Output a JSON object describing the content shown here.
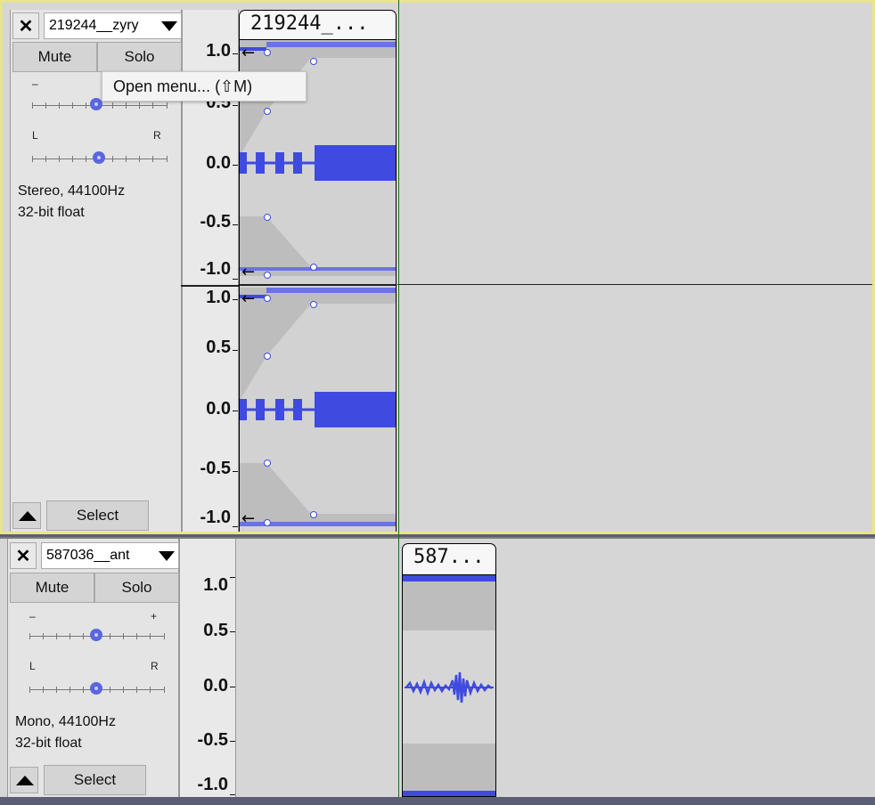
{
  "tracks": [
    {
      "name": "219244__zyry",
      "mute_label": "Mute",
      "solo_label": "Solo",
      "gain_minus": "–",
      "gain_plus": "+",
      "pan_left": "L",
      "pan_right": "R",
      "format_line1": "Stereo, 44100Hz",
      "format_line2": "32-bit float",
      "select_label": "Select",
      "clip_title": "219244_...",
      "ruler_channel1": [
        "1.0",
        "0.5",
        "0.0",
        "-0.5",
        "-1.0"
      ],
      "ruler_channel2": [
        "1.0",
        "0.5",
        "0.0",
        "-0.5",
        "-1.0"
      ],
      "selected": true
    },
    {
      "name": "587036__ant",
      "mute_label": "Mute",
      "solo_label": "Solo",
      "gain_minus": "–",
      "gain_plus": "+",
      "pan_left": "L",
      "pan_right": "R",
      "format_line1": "Mono, 44100Hz",
      "format_line2": "32-bit float",
      "select_label": "Select",
      "clip_title": "587...",
      "ruler_channel1": [
        "1.0",
        "0.5",
        "0.0",
        "-0.5",
        "-1.0"
      ],
      "selected": false
    }
  ],
  "tooltip": "Open menu... (⇧M)",
  "colors": {
    "waveform": "#3f4ae0",
    "selected_border": "#e8e58c",
    "cursor": "#1f6b1f",
    "envelope_band": "#bdbdbd"
  }
}
